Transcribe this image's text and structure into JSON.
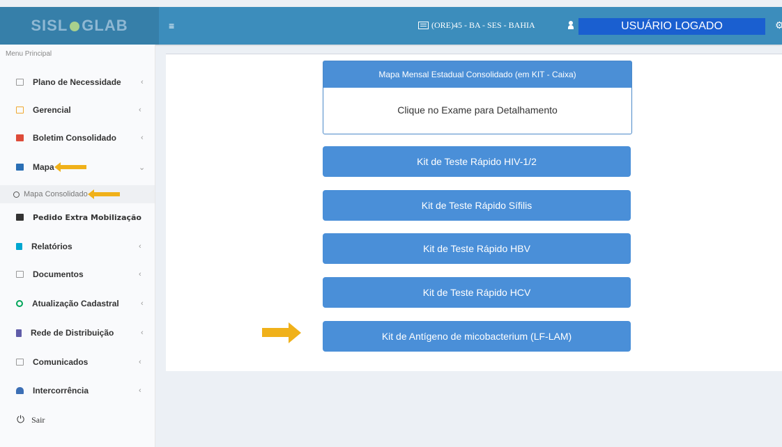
{
  "app": {
    "logo": {
      "part1": "SISL",
      "part2": "GLAB"
    },
    "hamburger": "≡",
    "unit_text": "(ORE)45 - BA - SES - BAHIA",
    "user_label": "USUÁRIO LOGADO",
    "colors": {
      "header": "#3c8dbc",
      "button": "#4a8fd8",
      "arrow": "#f0b11a"
    }
  },
  "sidebar": {
    "header": "Menu Principal",
    "items": [
      {
        "label": "Plano de Necessidade",
        "chevron": "‹",
        "icon": "edit-icon"
      },
      {
        "label": "Gerencial",
        "chevron": "‹",
        "icon": "edit-icon"
      },
      {
        "label": "Boletim Consolidado",
        "chevron": "‹",
        "icon": "calendar-icon"
      },
      {
        "label": "Mapa",
        "chevron": "⌄",
        "icon": "map-icon"
      },
      {
        "label": "Pedido Extra Mobilização",
        "chevron": "",
        "icon": "newspaper-icon"
      },
      {
        "label": "Relatórios",
        "chevron": "‹",
        "icon": "file-icon"
      },
      {
        "label": "Documentos",
        "chevron": "‹",
        "icon": "edit-icon"
      },
      {
        "label": "Atualização Cadastral",
        "chevron": "‹",
        "icon": "refresh-icon"
      },
      {
        "label": "Rede de Distribuição",
        "chevron": "‹",
        "icon": "building-icon"
      },
      {
        "label": "Comunicados",
        "chevron": "‹",
        "icon": "edit-icon"
      },
      {
        "label": "Intercorrência",
        "chevron": "‹",
        "icon": "user-icon"
      }
    ],
    "subitem": {
      "label": "Mapa Consolidado"
    },
    "logout": {
      "label": "Sair",
      "icon": "logout-icon"
    }
  },
  "main": {
    "panel": {
      "title": "Mapa Mensal Estadual Consolidado (em KIT - Caixa)",
      "body": "Clique no Exame para Detalhamento"
    },
    "buttons": [
      {
        "label": "Kit de Teste Rápido HIV-1/2"
      },
      {
        "label": "Kit de Teste Rápido Sífilis"
      },
      {
        "label": "Kit de Teste Rápido HBV"
      },
      {
        "label": "Kit de Teste Rápido HCV"
      },
      {
        "label": "Kit de Antígeno de micobacterium (LF-LAM)"
      }
    ]
  }
}
